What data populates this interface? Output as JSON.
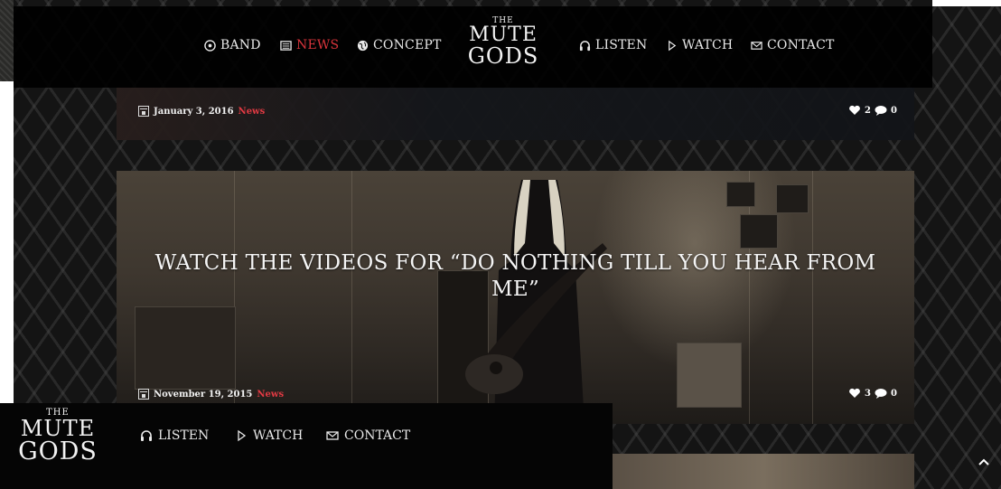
{
  "nav": {
    "items": [
      {
        "label": "BAND",
        "icon": "band-icon"
      },
      {
        "label": "NEWS",
        "icon": "news-icon"
      },
      {
        "label": "CONCEPT",
        "icon": "globe-icon"
      },
      {
        "label": "LISTEN",
        "icon": "headphones-icon"
      },
      {
        "label": "WATCH",
        "icon": "play-icon"
      },
      {
        "label": "CONTACT",
        "icon": "mail-icon"
      }
    ],
    "active_color": "#d9343b"
  },
  "logo": {
    "the": "THE",
    "mute": "MUTE",
    "gods": "GODS"
  },
  "posts": [
    {
      "date": "January 3, 2016",
      "category": "News",
      "likes": "2",
      "comments": "0"
    },
    {
      "title": "WATCH THE VIDEOS FOR “DO NOTHING TILL YOU HEAR FROM ME”",
      "date": "November 19, 2015",
      "category": "News",
      "likes": "3",
      "comments": "0"
    }
  ],
  "sticky_nav": {
    "items": [
      {
        "label": "LISTEN",
        "icon": "headphones-icon"
      },
      {
        "label": "WATCH",
        "icon": "play-icon"
      },
      {
        "label": "CONTACT",
        "icon": "mail-icon"
      }
    ]
  },
  "colors": {
    "accent": "#d9343b",
    "navbar": "#000000"
  }
}
